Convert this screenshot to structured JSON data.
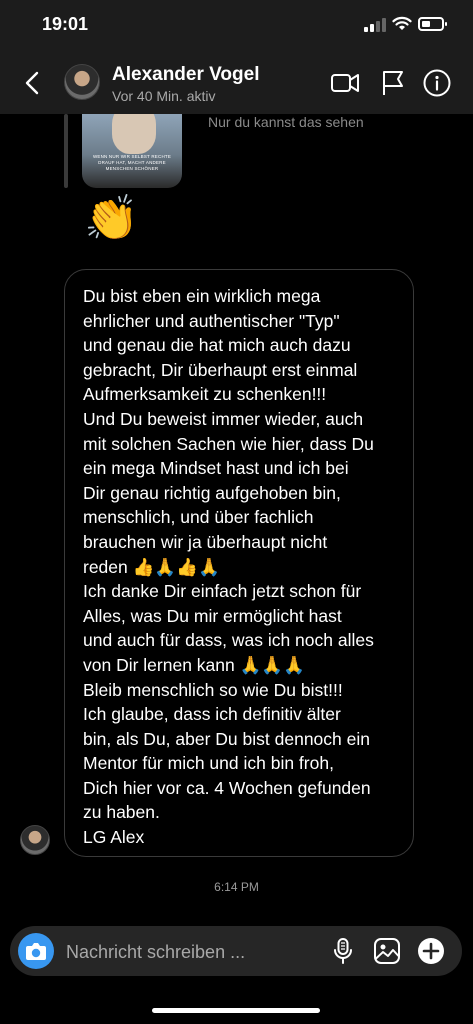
{
  "status_bar": {
    "time": "19:01"
  },
  "header": {
    "contact_name": "Alexander Vogel",
    "activity_status": "Vor 40 Min. aktiv",
    "icons": [
      "back-icon",
      "video-call-icon",
      "flag-icon",
      "info-icon"
    ]
  },
  "thread": {
    "story_caption": "WENN NUR WIR SELBST RECHTE DRAUF HAT, MACHT ANDERE MENSCHEN SCHÖNER",
    "story_note": "Nur du kannst das sehen",
    "reaction_emoji": "👏",
    "message_text": "Du bist eben ein wirklich mega\nehrlicher und authentischer \"Typ\"\nund genau die hat mich auch dazu\ngebracht, Dir überhaupt erst einmal\nAufmerksamkeit zu schenken!!!\nUnd Du beweist immer wieder, auch\nmit solchen Sachen wie hier, dass Du\nein mega Mindset hast und ich bei\nDir genau richtig aufgehoben bin,\nmenschlich, und über fachlich\nbrauchen wir ja überhaupt nicht\nreden 👍🙏👍🙏\nIch danke Dir einfach jetzt schon für\nAlles, was Du mir ermöglicht hast\nund auch für dass, was ich noch alles\nvon Dir lernen kann 🙏🙏🙏\nBleib menschlich so wie Du bist!!!\nIch glaube, dass ich definitiv älter\nbin, als Du, aber Du bist dennoch ein\nMentor für mich und ich bin froh,\nDich hier vor ca. 4 Wochen gefunden\nzu haben.\nLG Alex",
    "timestamp": "6:14 PM"
  },
  "composer": {
    "placeholder": "Nachricht schreiben ...",
    "icons": [
      "camera-icon",
      "microphone-icon",
      "gallery-icon",
      "add-icon"
    ]
  },
  "colors": {
    "background": "#000000",
    "bar_background": "#1c1c1c",
    "composer_background": "#262626",
    "camera_accent": "#3897f0",
    "bubble_border": "#3a3a3a"
  }
}
